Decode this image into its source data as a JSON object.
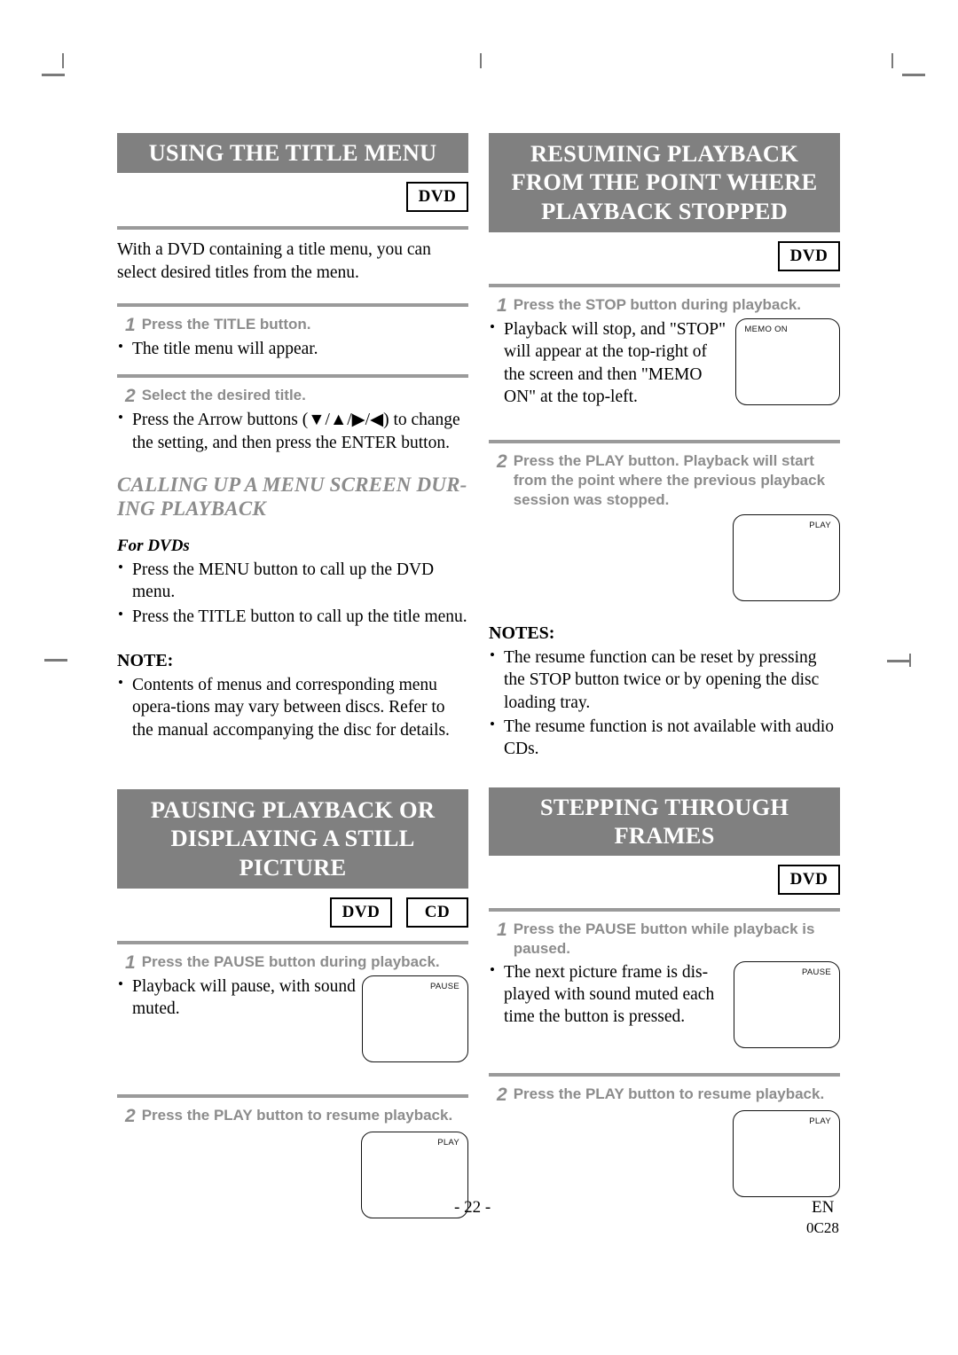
{
  "document": {
    "page_number": "- 22 -",
    "language_code": "EN",
    "doc_code": "0C28"
  },
  "sections": {
    "title_menu": {
      "heading": "USING THE TITLE MENU",
      "badges": [
        "DVD"
      ],
      "intro": "With a DVD containing a title menu, you can select desired titles from the menu.",
      "step1_num": "1",
      "step1": "Press the TITLE button.",
      "step1_bullet": "The title menu will appear.",
      "step2_num": "2",
      "step2": "Select the desired title.",
      "step2_bullet": "Press the Arrow buttons (▼/▲/▶/◀) to change the setting, and then press the ENTER button.",
      "subhead": "CALLING UP A MENU SCREEN DUR-ING PLAYBACK",
      "minihead": "For DVDs",
      "b1": "Press the MENU button to call up the DVD menu.",
      "b2": "Press the TITLE button to call up the title menu.",
      "note_head": "NOTE:",
      "note_1": "Contents of menus and corresponding menu opera-tions may vary between discs. Refer to the manual accompanying the disc for details."
    },
    "pausing": {
      "heading": "PAUSING PLAYBACK OR DISPLAYING A STILL PICTURE",
      "badges": [
        "DVD",
        "CD"
      ],
      "step1_num": "1",
      "step1": "Press the PAUSE button during playback.",
      "step1_bullet": "Playback will pause, with sound muted.",
      "tv1_osd": "PAUSE",
      "step2_num": "2",
      "step2": "Press the PLAY button to resume playback.",
      "tv2_osd": "PLAY"
    },
    "resuming": {
      "heading": "RESUMING PLAYBACK FROM THE POINT WHERE PLAYBACK STOPPED",
      "badges": [
        "DVD"
      ],
      "step1_num": "1",
      "step1": "Press the STOP button during playback.",
      "step1_bullet": "Playback will stop, and \"STOP\" will appear at the top-right of the screen and then \"MEMO ON\" at the top-left.",
      "tv1_osd": "MEMO ON",
      "step2_num": "2",
      "step2": "Press the PLAY button. Playback will start from the point where the previous playback session was stopped.",
      "tv2_osd": "PLAY",
      "notes_head": "NOTES:",
      "note_1": "The resume function can be reset by pressing the STOP button twice or by opening the disc loading tray.",
      "note_2": "The resume function is not available with audio CDs."
    },
    "stepping": {
      "heading": "STEPPING THROUGH FRAMES",
      "badges": [
        "DVD"
      ],
      "step1_num": "1",
      "step1": "Press the PAUSE button while playback is paused.",
      "step1_bullet": "The next picture frame is dis-played with sound muted each time the button is pressed.",
      "tv1_osd": "PAUSE",
      "step2_num": "2",
      "step2": "Press the PLAY button to resume playback.",
      "tv2_osd": "PLAY"
    }
  }
}
